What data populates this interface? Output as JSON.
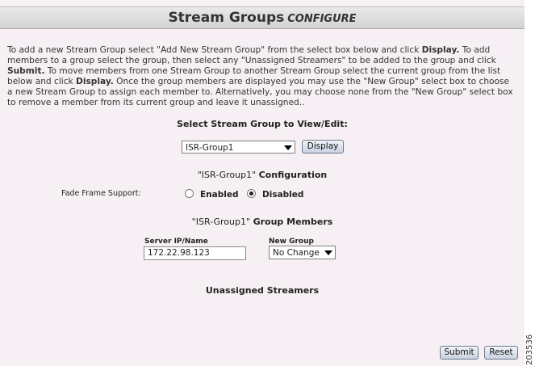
{
  "header": {
    "title": "Stream Groups",
    "subtitle": "CONFIGURE"
  },
  "intro": {
    "t1": "To add a new Stream Group select \"Add New Stream Group\" from the select box below and click ",
    "b1": "Display.",
    "t2": " To add members to a group select the group, then select any \"Unassigned Streamers\" to be added to the group and click ",
    "b2": "Submit.",
    "t3": " To move members from one Stream Group to another Stream Group select the current group from the list below and click ",
    "b3": "Display.",
    "t4": " Once the group members are displayed you may use the \"New Group\" select box to choose a new Stream Group to assign each member to. Alternatively, you may choose none from the \"New Group\" select box to remove a member from its current group and leave it unassigned.."
  },
  "group_select": {
    "label": "Select Stream Group to View/Edit:",
    "selected": "ISR-Group1",
    "display_button": "Display"
  },
  "configuration": {
    "group_name": "\"ISR-Group1\"",
    "heading_suffix": "Configuration",
    "fade_frame_label": "Fade Frame Support:",
    "option_enabled": "Enabled",
    "option_disabled": "Disabled",
    "selected_option": "Disabled"
  },
  "members": {
    "group_name": "\"ISR-Group1\"",
    "heading_suffix": "Group Members",
    "col_server": "Server IP/Name",
    "col_new_group": "New Group",
    "rows": [
      {
        "server": "172.22.98.123",
        "new_group": "No Change"
      }
    ]
  },
  "unassigned": {
    "heading": "Unassigned Streamers"
  },
  "footer": {
    "submit_button": "Submit",
    "reset_button": "Reset"
  },
  "figure_number": "203536"
}
